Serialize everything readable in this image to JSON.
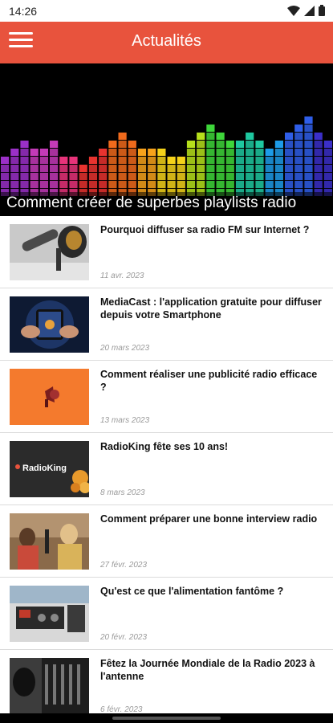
{
  "status_bar": {
    "time": "14:26"
  },
  "app_bar": {
    "title": "Actualités"
  },
  "hero": {
    "title": "Comment créer de superbes playlists radio",
    "bar_levels": [
      5,
      6,
      7,
      6,
      6,
      7,
      5,
      5,
      4,
      5,
      6,
      7,
      8,
      7,
      6,
      6,
      6,
      5,
      5,
      7,
      8,
      9,
      8,
      7,
      7,
      8,
      7,
      6,
      7,
      8,
      9,
      10,
      8,
      7
    ]
  },
  "articles": [
    {
      "title": "Pourquoi diffuser sa radio FM sur Internet ?",
      "date": "11 avr. 2023",
      "thumb": "microphone-thumbnail"
    },
    {
      "title": "MediaCast :  l'application gratuite pour diffuser depuis votre Smartphone",
      "date": "20 mars 2023",
      "thumb": "smartphone-thumbnail"
    },
    {
      "title": "Comment réaliser une publicité radio efficace ?",
      "date": "13 mars 2023",
      "thumb": "megaphone-thumbnail"
    },
    {
      "title": "RadioKing fête ses 10 ans!",
      "date": "8 mars 2023",
      "thumb": "radioking-thumbnail",
      "thumb_text": "RadioKing"
    },
    {
      "title": "Comment préparer une bonne interview radio",
      "date": "27 févr. 2023",
      "thumb": "interview-thumbnail"
    },
    {
      "title": "Qu'est ce que l'alimentation fantôme ?",
      "date": "20 févr. 2023",
      "thumb": "mixer-thumbnail"
    },
    {
      "title": "Fêtez la Journée Mondiale de la Radio 2023 à l'antenne",
      "date": "6 févr. 2023",
      "thumb": "studio-thumbnail"
    }
  ],
  "colors": {
    "accent": "#e8533d"
  }
}
